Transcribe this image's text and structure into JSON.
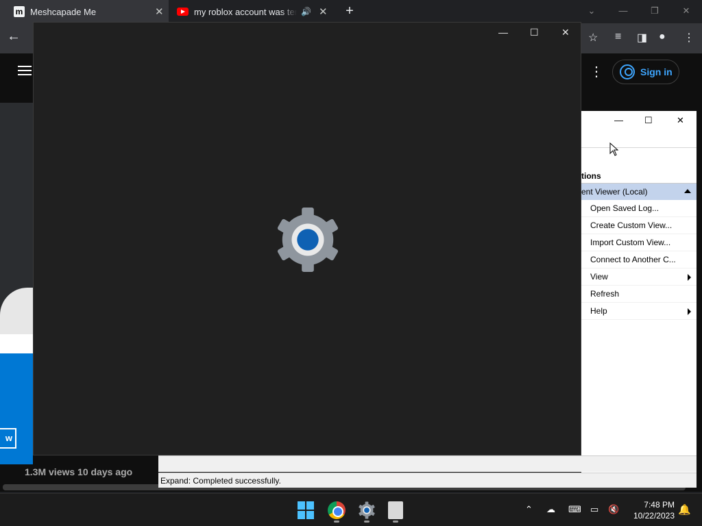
{
  "browser": {
    "tabs": [
      {
        "favicon": "meshcapade-favicon",
        "title": "Meshcapade Me",
        "active": true
      },
      {
        "favicon": "youtube-favicon",
        "title": "my roblox account was term",
        "audio": "🔊"
      }
    ],
    "new_tab": "+",
    "signin_label": "Sign in",
    "video_stats": "1.3M views  10 days ago"
  },
  "settings_window": {
    "icon": "gear-icon",
    "colors": {
      "background": "#202020",
      "gear": "#8f969e",
      "center": "#0f61b3"
    }
  },
  "event_viewer": {
    "actions_header": "tions",
    "selected_item": "ent Viewer (Local)",
    "items": [
      {
        "label": "Open Saved Log...",
        "submenu": false
      },
      {
        "label": "Create Custom View...",
        "submenu": false
      },
      {
        "label": "Import Custom View...",
        "submenu": false
      },
      {
        "label": "Connect to Another C...",
        "submenu": false
      },
      {
        "label": "View",
        "submenu": true
      },
      {
        "label": "Refresh",
        "submenu": false
      },
      {
        "label": "Help",
        "submenu": true
      }
    ],
    "status": "Expand:  Completed successfully."
  },
  "dialog_fragment": {
    "button_label": "w",
    "accent": "#0078d4"
  },
  "taskbar": {
    "apps": [
      "start-icon",
      "chrome-icon",
      "settings-icon",
      "event-viewer-icon"
    ],
    "time": "7:48 PM",
    "date": "10/22/2023"
  }
}
